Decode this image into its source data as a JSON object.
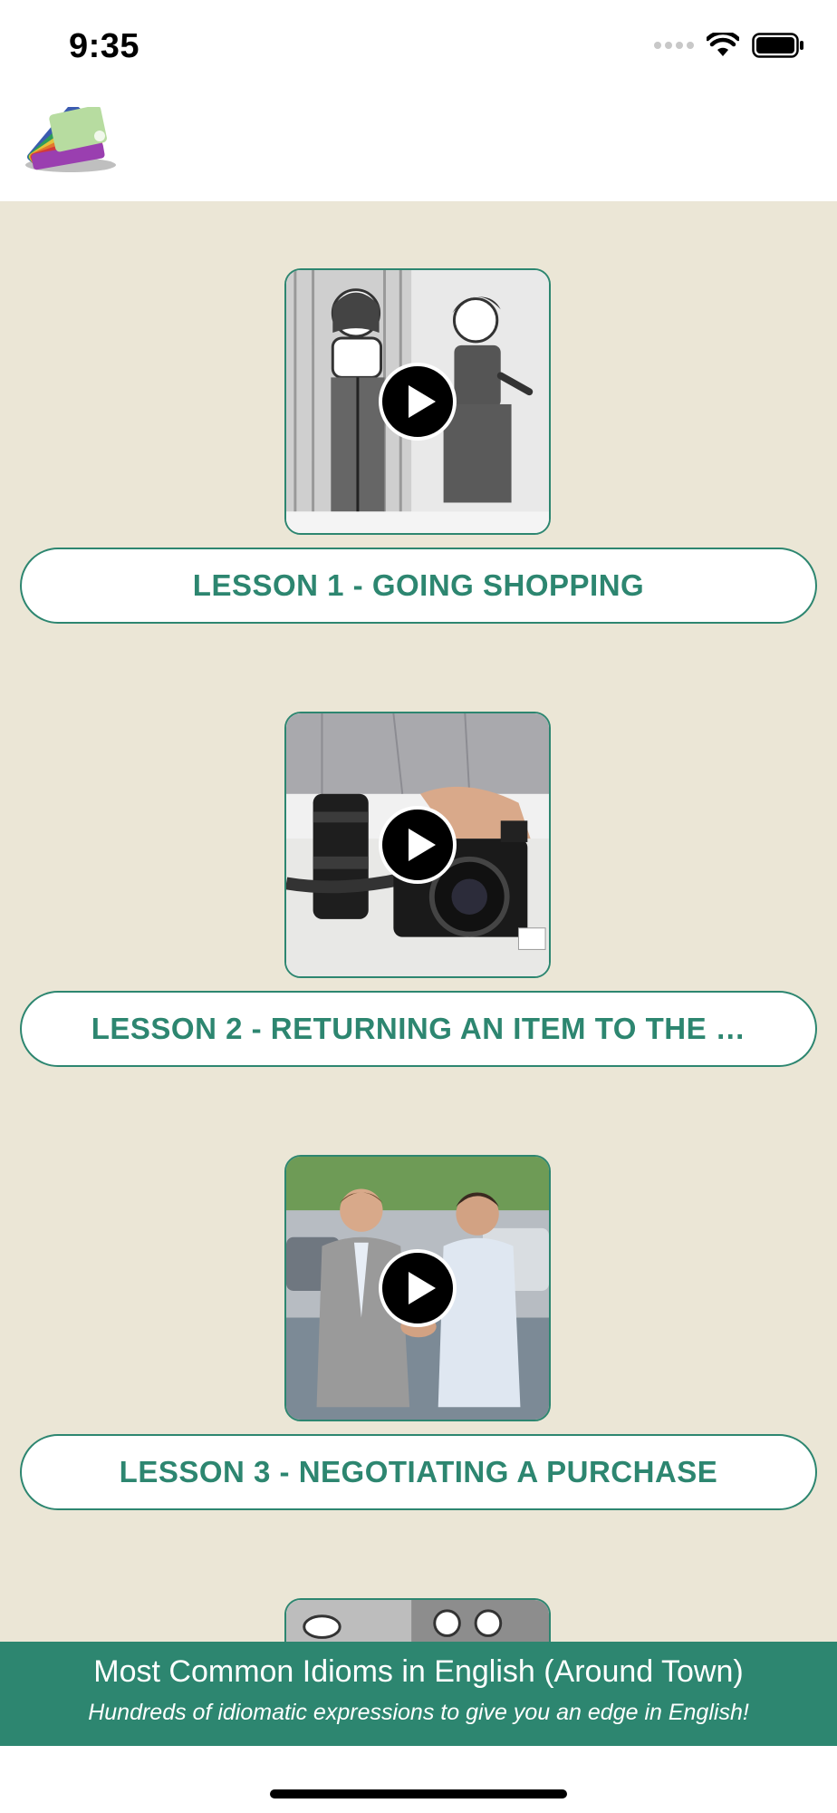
{
  "status_bar": {
    "time": "9:35",
    "icons": [
      "cellular-dots-icon",
      "wifi-icon",
      "battery-icon"
    ]
  },
  "header": {
    "logo": "idiom-cards-fan-logo"
  },
  "lessons": [
    {
      "label": "LESSON 1 - GOING SHOPPING",
      "thumbnail": "cartoon-shopping-fitting-room"
    },
    {
      "label": "LESSON 2 - RETURNING AN ITEM TO THE …",
      "thumbnail": "camera-and-lens-on-table"
    },
    {
      "label": "LESSON 3 - NEGOTIATING A PURCHASE",
      "thumbnail": "handshake-at-car-lot"
    },
    {
      "label": "",
      "thumbnail": "cartoon-partial"
    }
  ],
  "banner": {
    "title": "Most Common Idioms in English (Around Town)",
    "subtitle": "Hundreds of idiomatic expressions to give you an edge in English!"
  },
  "colors": {
    "accent": "#2d8670",
    "content_bg": "#ebe6d6"
  }
}
